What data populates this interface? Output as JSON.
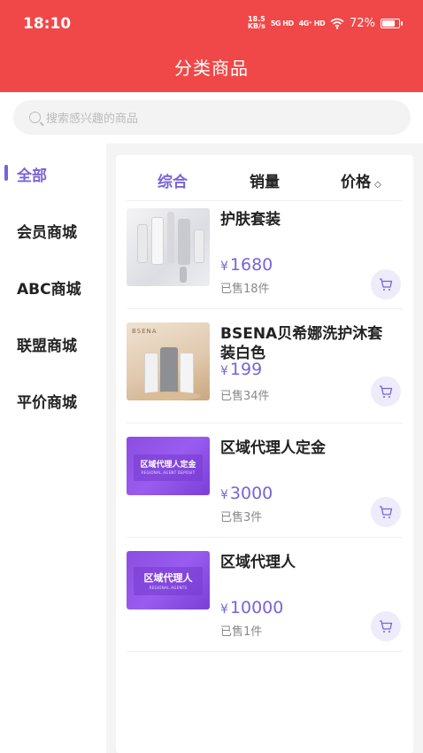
{
  "status": {
    "time": "18:10",
    "net_speed_top": "18.5",
    "net_speed_unit": "KB/s",
    "sig1": "5G HD",
    "sig2": "4G⁺ HD",
    "battery": "72%"
  },
  "header": {
    "title": "分类商品"
  },
  "search": {
    "placeholder": "搜索感兴趣的商品"
  },
  "sidebar": {
    "items": [
      {
        "label": "全部"
      },
      {
        "label": "会员商城"
      },
      {
        "label": "ABC商城"
      },
      {
        "label": "联盟商城"
      },
      {
        "label": "平价商城"
      }
    ]
  },
  "tabs": {
    "comprehensive": "综合",
    "sales": "销量",
    "price": "价格",
    "price_sort_icon": "◇"
  },
  "currency": "¥",
  "products": [
    {
      "name": "护肤套装",
      "price": "1680",
      "sold": "已售18件",
      "thumb": "skincare-set"
    },
    {
      "name": "BSENA贝希娜洗护沐套装白色",
      "price": "199",
      "sold": "已售34件",
      "thumb": "bsena-set",
      "thumb_brand": "BSENA"
    },
    {
      "name": "区域代理人定金",
      "price": "3000",
      "sold": "已售3件",
      "thumb": "agent-deposit",
      "thumb_text": "区域代理人定金",
      "thumb_sub": "REGIONAL AGENT DEPOSIT"
    },
    {
      "name": "区域代理人",
      "price": "10000",
      "sold": "已售1件",
      "thumb": "regional-agent",
      "thumb_text": "区域代理人",
      "thumb_sub": "REGIONAL AGENTS"
    }
  ],
  "colors": {
    "header": "#f04848",
    "accent": "#7a63d8",
    "cart_bg": "#eeebfb"
  }
}
